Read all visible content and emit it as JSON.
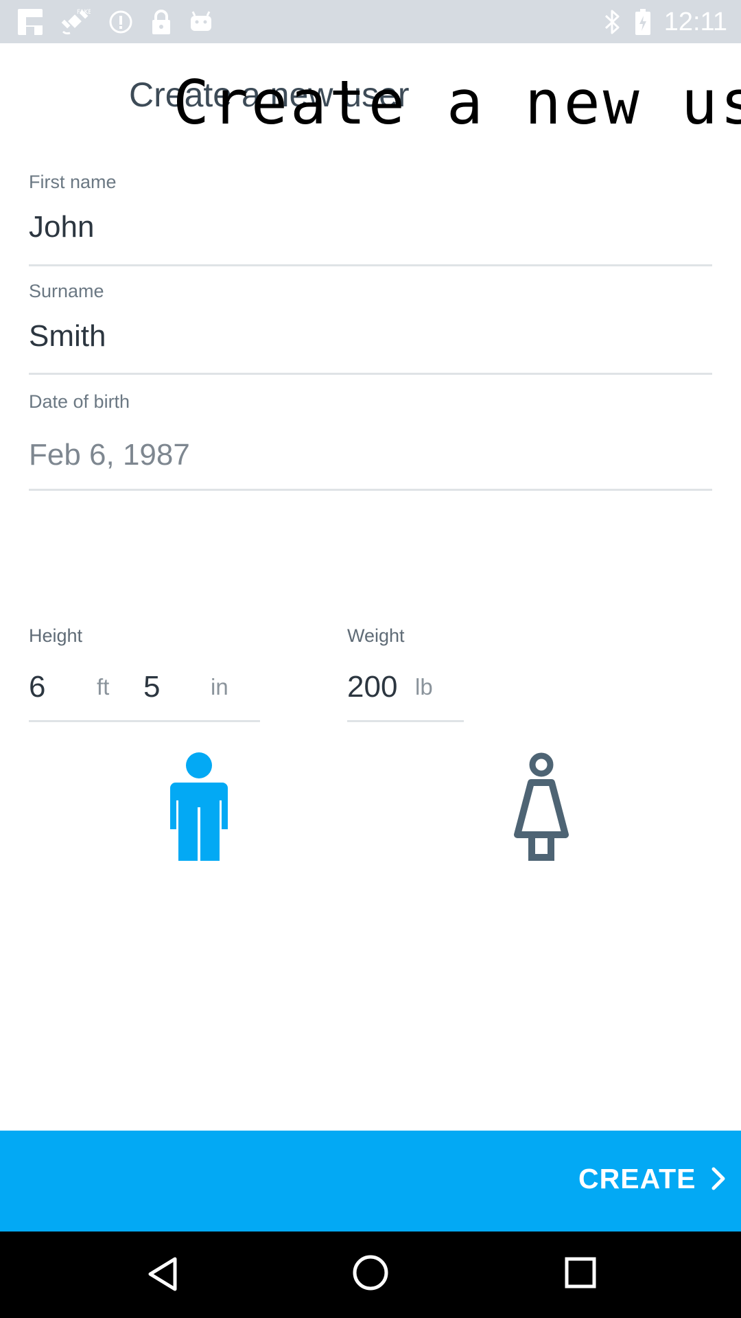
{
  "status_bar": {
    "time": "12:11",
    "left_icons": [
      "flipboard-icon",
      "fake-gps-icon",
      "info-icon",
      "lock-icon",
      "android-icon"
    ],
    "right_icons": [
      "bluetooth-icon",
      "battery-icon"
    ]
  },
  "header": {
    "title": "Create a new user",
    "title_overlay": "Create a new user"
  },
  "form": {
    "first_name": {
      "label": "First name",
      "value": "John"
    },
    "surname": {
      "label": "Surname",
      "value": "Smith"
    },
    "dob": {
      "label": "Date of birth",
      "value": "Feb 6, 1987"
    }
  },
  "height": {
    "label": "Height",
    "feet": "6",
    "feet_unit": "ft",
    "inches": "5",
    "inches_unit": "in"
  },
  "weight": {
    "label": "Weight",
    "value": "200",
    "unit": "lb"
  },
  "gender": {
    "male_icon": "male-person-icon",
    "female_icon": "female-person-icon",
    "selected": "male"
  },
  "colors": {
    "accent": "#03a9f4",
    "inactive_icon": "#4e6474",
    "status_bar": "#d6dbe1",
    "nav_bar": "#000000"
  },
  "action": {
    "create_label": "CREATE"
  },
  "nav": {
    "icons": [
      "back-icon",
      "home-icon",
      "recents-icon"
    ]
  }
}
